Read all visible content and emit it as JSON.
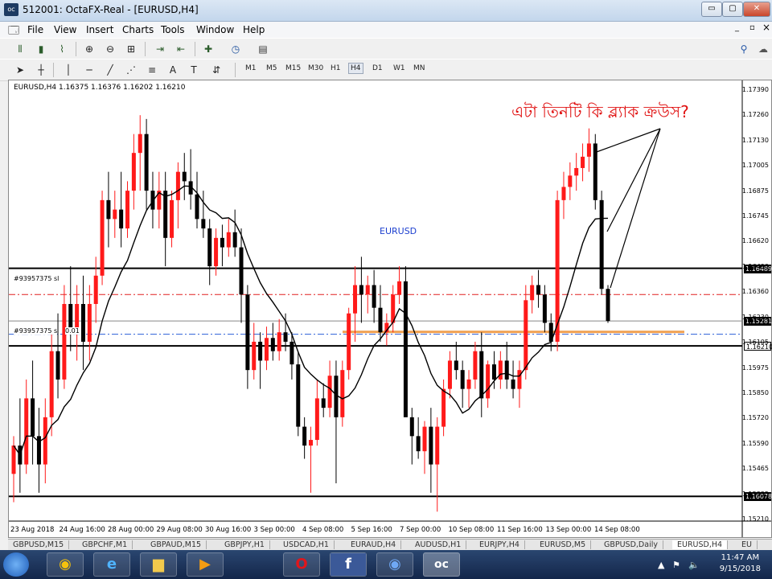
{
  "window": {
    "title": "512001: OctaFX-Real - [EURUSD,H4]",
    "app_icon": "oc",
    "controls": {
      "minimize": "▭",
      "restore": "▢",
      "close": "✕"
    },
    "inner_controls": {
      "minimize": "_",
      "restore": "▫",
      "close": "×"
    }
  },
  "menu": [
    "File",
    "View",
    "Insert",
    "Charts",
    "Tools",
    "Window",
    "Help"
  ],
  "timeframes": [
    "M1",
    "M5",
    "M15",
    "M30",
    "H1",
    "H4",
    "D1",
    "W1",
    "MN"
  ],
  "active_timeframe": "H4",
  "chart": {
    "header": "EURUSD,H4  1.16375 1.16376 1.16202 1.16210",
    "symbol_label": "EURUSD",
    "annotation": "এটা তিনটি কি ব্ল্যাক ক্রউস?",
    "order_sl_label": "#93957375 sl",
    "order_label": "#93957375 s",
    "order_lot": "0.01",
    "price_tags": [
      "1.16489",
      "1.16210",
      "1.16078",
      "1.15281"
    ],
    "y_ticks": [
      "1.17390",
      "1.17260",
      "1.17130",
      "1.17005",
      "1.16875",
      "1.16745",
      "1.16620",
      "1.16490",
      "1.16360",
      "1.16230",
      "1.16105",
      "1.15975",
      "1.15850",
      "1.15720",
      "1.15590",
      "1.15465",
      "1.15335",
      "1.15210"
    ],
    "x_ticks": [
      "23 Aug 2018",
      "24 Aug 16:00",
      "28 Aug 00:00",
      "29 Aug 08:00",
      "30 Aug 16:00",
      "3 Sep 00:00",
      "4 Sep 08:00",
      "5 Sep 16:00",
      "7 Sep 00:00",
      "10 Sep 08:00",
      "11 Sep 16:00",
      "13 Sep 00:00",
      "14 Sep 08:00"
    ],
    "colors": {
      "bull": "#ff1a1a",
      "bear": "#000000",
      "annotation": "#e01010",
      "symbol": "#1c3fcf",
      "sl_line": "#e02020",
      "order_line": "#2a5ed8",
      "tp_zone": "#f0a050"
    }
  },
  "tabs": [
    "GBPUSD,M15",
    "GBPCHF,M1",
    "GBPAUD,M15",
    "GBPJPY,H1",
    "USDCAD,H1",
    "EURAUD,H4",
    "AUDUSD,H1",
    "EURJPY,H4",
    "EURUSD,M5",
    "GBPUSD,Daily",
    "EURUSD,H4",
    "EU"
  ],
  "taskbar": {
    "apps": [
      "chrome-icon",
      "ie-icon",
      "folder-icon",
      "media-player-icon",
      "opera-icon",
      "facebook-icon",
      "chrome-alt-icon",
      "octafx-icon"
    ],
    "time": "11:47 AM",
    "date": "9/15/2018"
  },
  "chart_data": {
    "type": "candlestick",
    "symbol": "EURUSD",
    "timeframe": "H4",
    "ylim": [
      1.1515,
      1.1745
    ],
    "horizontal_lines": [
      1.16489,
      1.16078,
      1.15281,
      1.1621
    ],
    "candles": [
      {
        "o": 1.154,
        "h": 1.156,
        "l": 1.1525,
        "c": 1.1555
      },
      {
        "o": 1.1555,
        "h": 1.158,
        "l": 1.153,
        "c": 1.1545
      },
      {
        "o": 1.1545,
        "h": 1.159,
        "l": 1.154,
        "c": 1.158
      },
      {
        "o": 1.158,
        "h": 1.16,
        "l": 1.1545,
        "c": 1.156
      },
      {
        "o": 1.156,
        "h": 1.1575,
        "l": 1.153,
        "c": 1.1545
      },
      {
        "o": 1.1545,
        "h": 1.158,
        "l": 1.1535,
        "c": 1.157
      },
      {
        "o": 1.157,
        "h": 1.1615,
        "l": 1.156,
        "c": 1.1605
      },
      {
        "o": 1.1605,
        "h": 1.1625,
        "l": 1.158,
        "c": 1.159
      },
      {
        "o": 1.159,
        "h": 1.164,
        "l": 1.1585,
        "c": 1.163
      },
      {
        "o": 1.163,
        "h": 1.165,
        "l": 1.1605,
        "c": 1.1615
      },
      {
        "o": 1.1615,
        "h": 1.164,
        "l": 1.16,
        "c": 1.163
      },
      {
        "o": 1.163,
        "h": 1.1645,
        "l": 1.1595,
        "c": 1.161
      },
      {
        "o": 1.161,
        "h": 1.164,
        "l": 1.16,
        "c": 1.163
      },
      {
        "o": 1.163,
        "h": 1.1655,
        "l": 1.162,
        "c": 1.1645
      },
      {
        "o": 1.1645,
        "h": 1.169,
        "l": 1.164,
        "c": 1.1685
      },
      {
        "o": 1.1685,
        "h": 1.17,
        "l": 1.166,
        "c": 1.1675
      },
      {
        "o": 1.1675,
        "h": 1.169,
        "l": 1.1665,
        "c": 1.168
      },
      {
        "o": 1.168,
        "h": 1.17,
        "l": 1.166,
        "c": 1.167
      },
      {
        "o": 1.167,
        "h": 1.1695,
        "l": 1.1665,
        "c": 1.169
      },
      {
        "o": 1.169,
        "h": 1.172,
        "l": 1.168,
        "c": 1.171
      },
      {
        "o": 1.171,
        "h": 1.173,
        "l": 1.169,
        "c": 1.172
      },
      {
        "o": 1.172,
        "h": 1.1728,
        "l": 1.168,
        "c": 1.169
      },
      {
        "o": 1.169,
        "h": 1.17,
        "l": 1.167,
        "c": 1.168
      },
      {
        "o": 1.168,
        "h": 1.17,
        "l": 1.167,
        "c": 1.169
      },
      {
        "o": 1.169,
        "h": 1.17,
        "l": 1.165,
        "c": 1.1665
      },
      {
        "o": 1.1665,
        "h": 1.169,
        "l": 1.166,
        "c": 1.1685
      },
      {
        "o": 1.1685,
        "h": 1.1705,
        "l": 1.167,
        "c": 1.17
      },
      {
        "o": 1.17,
        "h": 1.171,
        "l": 1.1685,
        "c": 1.1695
      },
      {
        "o": 1.1695,
        "h": 1.1712,
        "l": 1.168,
        "c": 1.1688
      },
      {
        "o": 1.1688,
        "h": 1.17,
        "l": 1.167,
        "c": 1.1675
      },
      {
        "o": 1.1675,
        "h": 1.169,
        "l": 1.1665,
        "c": 1.167
      },
      {
        "o": 1.167,
        "h": 1.1675,
        "l": 1.164,
        "c": 1.165
      },
      {
        "o": 1.165,
        "h": 1.167,
        "l": 1.1645,
        "c": 1.1665
      },
      {
        "o": 1.1665,
        "h": 1.1672,
        "l": 1.165,
        "c": 1.166
      },
      {
        "o": 1.166,
        "h": 1.1675,
        "l": 1.1655,
        "c": 1.1668
      },
      {
        "o": 1.1668,
        "h": 1.168,
        "l": 1.1655,
        "c": 1.166
      },
      {
        "o": 1.166,
        "h": 1.167,
        "l": 1.162,
        "c": 1.1635
      },
      {
        "o": 1.1635,
        "h": 1.164,
        "l": 1.1585,
        "c": 1.1595
      },
      {
        "o": 1.1595,
        "h": 1.162,
        "l": 1.159,
        "c": 1.161
      },
      {
        "o": 1.161,
        "h": 1.1615,
        "l": 1.1585,
        "c": 1.16
      },
      {
        "o": 1.16,
        "h": 1.1618,
        "l": 1.1595,
        "c": 1.1612
      },
      {
        "o": 1.1612,
        "h": 1.162,
        "l": 1.16,
        "c": 1.1605
      },
      {
        "o": 1.1605,
        "h": 1.1622,
        "l": 1.16,
        "c": 1.1615
      },
      {
        "o": 1.1615,
        "h": 1.1625,
        "l": 1.1605,
        "c": 1.161
      },
      {
        "o": 1.161,
        "h": 1.1615,
        "l": 1.159,
        "c": 1.1598
      },
      {
        "o": 1.1598,
        "h": 1.1605,
        "l": 1.156,
        "c": 1.1565
      },
      {
        "o": 1.1565,
        "h": 1.157,
        "l": 1.1548,
        "c": 1.1555
      },
      {
        "o": 1.1555,
        "h": 1.1565,
        "l": 1.153,
        "c": 1.1558
      },
      {
        "o": 1.1558,
        "h": 1.159,
        "l": 1.1555,
        "c": 1.158
      },
      {
        "o": 1.158,
        "h": 1.1588,
        "l": 1.157,
        "c": 1.1575
      },
      {
        "o": 1.1575,
        "h": 1.16,
        "l": 1.157,
        "c": 1.1592
      },
      {
        "o": 1.1592,
        "h": 1.16,
        "l": 1.1535,
        "c": 1.157
      },
      {
        "o": 1.157,
        "h": 1.16,
        "l": 1.1565,
        "c": 1.1595
      },
      {
        "o": 1.1595,
        "h": 1.1628,
        "l": 1.159,
        "c": 1.1625
      },
      {
        "o": 1.1625,
        "h": 1.165,
        "l": 1.161,
        "c": 1.164
      },
      {
        "o": 1.164,
        "h": 1.1655,
        "l": 1.162,
        "c": 1.1635
      },
      {
        "o": 1.1635,
        "h": 1.1645,
        "l": 1.1625,
        "c": 1.164
      },
      {
        "o": 1.164,
        "h": 1.1648,
        "l": 1.162,
        "c": 1.1628
      },
      {
        "o": 1.1628,
        "h": 1.164,
        "l": 1.161,
        "c": 1.1615
      },
      {
        "o": 1.1615,
        "h": 1.1625,
        "l": 1.1608,
        "c": 1.162
      },
      {
        "o": 1.162,
        "h": 1.164,
        "l": 1.1615,
        "c": 1.1635
      },
      {
        "o": 1.1635,
        "h": 1.165,
        "l": 1.163,
        "c": 1.1642
      },
      {
        "o": 1.1642,
        "h": 1.165,
        "l": 1.16,
        "c": 1.157
      },
      {
        "o": 1.157,
        "h": 1.1575,
        "l": 1.1545,
        "c": 1.156
      },
      {
        "o": 1.156,
        "h": 1.157,
        "l": 1.1548,
        "c": 1.1552
      },
      {
        "o": 1.1552,
        "h": 1.1568,
        "l": 1.154,
        "c": 1.1565
      },
      {
        "o": 1.1565,
        "h": 1.1575,
        "l": 1.153,
        "c": 1.1545
      },
      {
        "o": 1.1545,
        "h": 1.157,
        "l": 1.152,
        "c": 1.1565
      },
      {
        "o": 1.1565,
        "h": 1.159,
        "l": 1.156,
        "c": 1.1585
      },
      {
        "o": 1.1585,
        "h": 1.1605,
        "l": 1.158,
        "c": 1.16
      },
      {
        "o": 1.16,
        "h": 1.161,
        "l": 1.159,
        "c": 1.1595
      },
      {
        "o": 1.1595,
        "h": 1.16,
        "l": 1.1575,
        "c": 1.1585
      },
      {
        "o": 1.1585,
        "h": 1.1595,
        "l": 1.1575,
        "c": 1.159
      },
      {
        "o": 1.159,
        "h": 1.161,
        "l": 1.1585,
        "c": 1.1605
      },
      {
        "o": 1.1605,
        "h": 1.1615,
        "l": 1.157,
        "c": 1.158
      },
      {
        "o": 1.158,
        "h": 1.16,
        "l": 1.1575,
        "c": 1.1598
      },
      {
        "o": 1.1598,
        "h": 1.1605,
        "l": 1.1585,
        "c": 1.159
      },
      {
        "o": 1.159,
        "h": 1.1605,
        "l": 1.1585,
        "c": 1.16
      },
      {
        "o": 1.16,
        "h": 1.161,
        "l": 1.1585,
        "c": 1.159
      },
      {
        "o": 1.159,
        "h": 1.16,
        "l": 1.158,
        "c": 1.1585
      },
      {
        "o": 1.1585,
        "h": 1.16,
        "l": 1.1575,
        "c": 1.1595
      },
      {
        "o": 1.1595,
        "h": 1.164,
        "l": 1.159,
        "c": 1.1632
      },
      {
        "o": 1.1632,
        "h": 1.1645,
        "l": 1.1625,
        "c": 1.164
      },
      {
        "o": 1.164,
        "h": 1.1648,
        "l": 1.1628,
        "c": 1.1635
      },
      {
        "o": 1.1635,
        "h": 1.164,
        "l": 1.1615,
        "c": 1.162
      },
      {
        "o": 1.162,
        "h": 1.1625,
        "l": 1.1605,
        "c": 1.161
      },
      {
        "o": 1.161,
        "h": 1.169,
        "l": 1.1605,
        "c": 1.1685
      },
      {
        "o": 1.1685,
        "h": 1.17,
        "l": 1.1675,
        "c": 1.1692
      },
      {
        "o": 1.1692,
        "h": 1.1705,
        "l": 1.1685,
        "c": 1.1698
      },
      {
        "o": 1.1698,
        "h": 1.171,
        "l": 1.169,
        "c": 1.1702
      },
      {
        "o": 1.1702,
        "h": 1.1715,
        "l": 1.1695,
        "c": 1.1708
      },
      {
        "o": 1.1708,
        "h": 1.1723,
        "l": 1.17,
        "c": 1.1715
      },
      {
        "o": 1.1715,
        "h": 1.172,
        "l": 1.168,
        "c": 1.1685
      },
      {
        "o": 1.1685,
        "h": 1.169,
        "l": 1.1635,
        "c": 1.1638
      },
      {
        "o": 1.1638,
        "h": 1.164,
        "l": 1.162,
        "c": 1.1621
      }
    ]
  }
}
